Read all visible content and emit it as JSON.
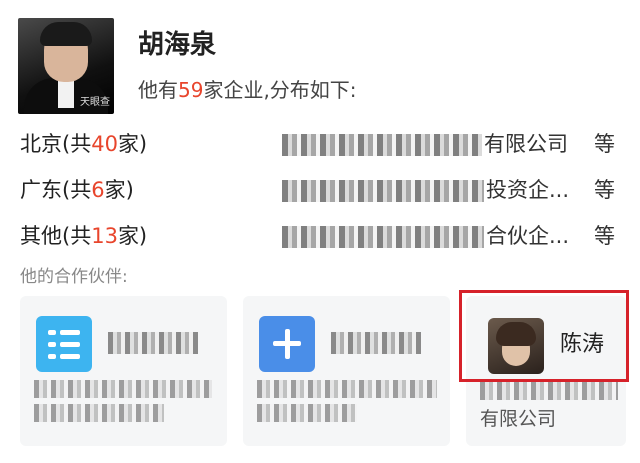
{
  "person": {
    "name": "胡海泉",
    "summary_prefix": "他有",
    "company_count": "59",
    "summary_suffix": "家企业,分布如下:",
    "avatar_watermark": "天眼查"
  },
  "regions": [
    {
      "label_prefix": "北京(共",
      "count": "40",
      "label_suffix": "家)",
      "company_suffix": "有限公司",
      "more": "等"
    },
    {
      "label_prefix": "广东(共",
      "count": "6",
      "label_suffix": "家)",
      "company_suffix": "投资企...",
      "more": "等"
    },
    {
      "label_prefix": "其他(共",
      "count": "13",
      "label_suffix": "家)",
      "company_suffix": "合伙企...",
      "more": "等"
    }
  ],
  "partners": {
    "label": "他的合作伙伴:",
    "cards": [
      {
        "logo_color": "#3db4f0"
      },
      {
        "logo_color": "#4a8ee8"
      },
      {
        "name": "陈涛",
        "company_suffix": "有限公司",
        "highlight_color": "#d6222a"
      }
    ]
  }
}
